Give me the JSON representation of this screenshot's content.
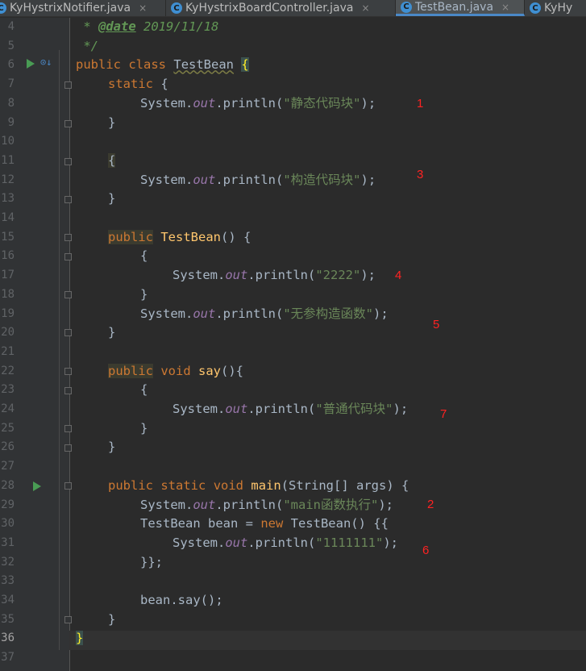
{
  "tabs": [
    {
      "label": "KyHystrixNotifier.java",
      "active": false
    },
    {
      "label": "KyHystrixBoardController.java",
      "active": false
    },
    {
      "label": "TestBean.java",
      "active": true
    },
    {
      "label": "KyHy",
      "active": false
    }
  ],
  "tab_icon_letter": "C",
  "tab_close_symbol": "×",
  "line_numbers": [
    "4",
    "5",
    "6",
    "7",
    "8",
    "9",
    "10",
    "11",
    "12",
    "13",
    "14",
    "15",
    "16",
    "17",
    "18",
    "19",
    "20",
    "21",
    "22",
    "23",
    "24",
    "25",
    "26",
    "27",
    "28",
    "29",
    "30",
    "31",
    "32",
    "33",
    "34",
    "35",
    "36",
    "37"
  ],
  "code": {
    "l4_prefix": " * ",
    "l4_tag": "@date",
    "l4_value": " 2019/11/18",
    "l5": " */",
    "l6_public": "public",
    "l6_class": "class",
    "l6_name": "TestBean",
    "l6_brace": "{",
    "l7_static": "static",
    "l7_brace": "{",
    "sysout": "System.",
    "out": "out",
    "println": ".println(",
    "end": ");",
    "str1": "\"静态代码块\"",
    "close": "}",
    "open": "{",
    "str3": "\"构造代码块\"",
    "public": "public",
    "ctor_name": "TestBean",
    "ctor_sig": "() {",
    "str4": "\"2222\"",
    "str5": "\"无参构造函数\"",
    "void": "void",
    "say": "say",
    "say_sig": "(){",
    "str7": "\"普通代码块\"",
    "static_kw": "static",
    "main": "main",
    "main_sig": "(String[] args) {",
    "str2": "\"main函数执行\"",
    "l30_decl": "TestBean bean = ",
    "new": "new",
    "l30_rest": " TestBean() {{",
    "str6": "\"1111111\"",
    "l32": "}};",
    "l34": "bean.say();"
  },
  "annotations": [
    "1",
    "3",
    "4",
    "5",
    "7",
    "2",
    "6"
  ],
  "colors": {
    "keyword": "#cc7832",
    "string": "#6a8759",
    "method": "#ffc66d",
    "field": "#9876aa",
    "annotation": "#ff2222"
  }
}
